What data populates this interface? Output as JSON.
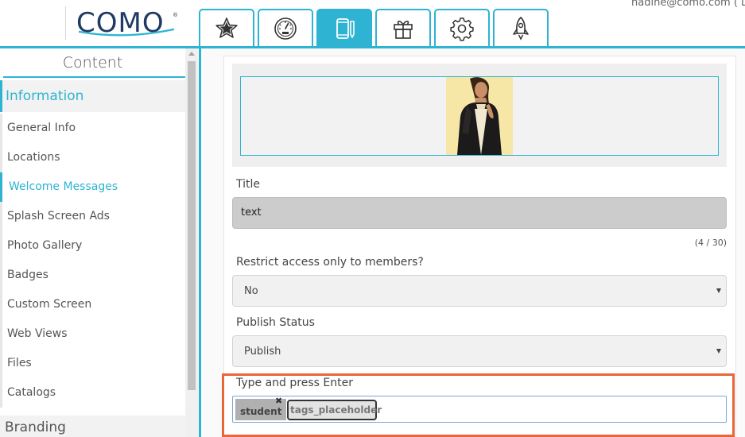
{
  "header": {
    "logo_text": "COMO",
    "logo_reg": "®",
    "user_email": "nadine@como.com ( Lo",
    "tabs": [
      {
        "icon": "star-icon",
        "active": false
      },
      {
        "icon": "gauge-icon",
        "active": false
      },
      {
        "icon": "mobile-edit-icon",
        "active": true
      },
      {
        "icon": "gift-icon",
        "active": false
      },
      {
        "icon": "gear-icon",
        "active": false
      },
      {
        "icon": "rocket-icon",
        "active": false
      }
    ]
  },
  "sidebar": {
    "title": "Content",
    "section_information": "Information",
    "items": [
      {
        "label": "General Info"
      },
      {
        "label": "Locations"
      },
      {
        "label": "Welcome Messages"
      },
      {
        "label": "Splash Screen Ads"
      },
      {
        "label": "Photo Gallery"
      },
      {
        "label": "Badges"
      },
      {
        "label": "Custom Screen"
      },
      {
        "label": "Web Views"
      },
      {
        "label": "Files"
      },
      {
        "label": "Catalogs"
      }
    ],
    "active_item": "Welcome Messages",
    "section_branding": "Branding"
  },
  "form": {
    "title_label": "Title",
    "title_value": "text",
    "title_counter": "(4 / 30)",
    "restrict_label": "Restrict access only to members?",
    "restrict_value": "No",
    "publish_label": "Publish Status",
    "publish_value": "Publish",
    "tags_label": "Type and press Enter",
    "tags": [
      "student"
    ],
    "tag_remove": "✖",
    "tags_placeholder": "tags_placeholder"
  },
  "colors": {
    "accent": "#2eb4d2",
    "highlight": "#e8663a",
    "logo": "#1f3a63"
  }
}
